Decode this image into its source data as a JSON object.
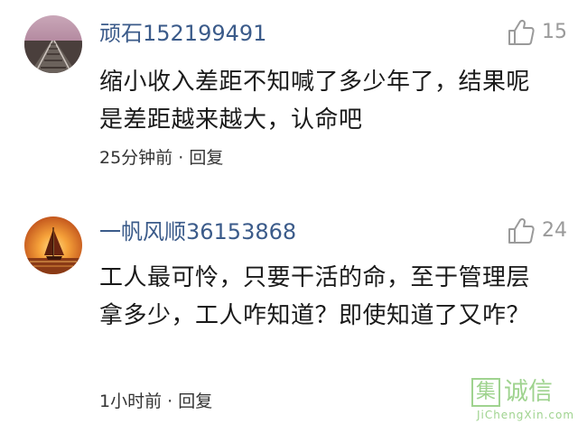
{
  "comments": [
    {
      "username": "顽石152199491",
      "likes": "15",
      "text": "缩小收入差距不知喊了多少年了，结果呢是差距越来越大，认命吧",
      "time": "25分钟前",
      "separator": "·",
      "reply_label": "回复",
      "avatar": "railway-track-avatar"
    },
    {
      "username": "一帆风顺36153868",
      "likes": "24",
      "text": "工人最可怜，只要干活的命，至于管理层拿多少，工人咋知道？即使知道了又咋？",
      "time": "1小时前",
      "separator": "·",
      "reply_label": "回复",
      "avatar": "sailboat-sunset-avatar"
    }
  ],
  "watermark": {
    "box_char": "集",
    "chars": "诚信",
    "subtitle": "JiChengXin.com"
  },
  "colors": {
    "username": "#3b5b8a",
    "like_count": "#9a9a9a",
    "watermark": "#9fd38f"
  }
}
